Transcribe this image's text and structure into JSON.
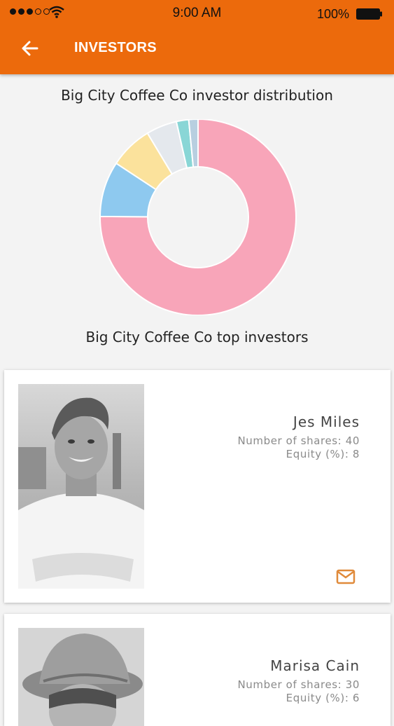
{
  "status_bar": {
    "time": "9:00 AM",
    "battery": "100%"
  },
  "header": {
    "title": "INVESTORS",
    "back_icon": "arrow-left-icon"
  },
  "distribution": {
    "title": "Big City Coffee Co investor distribution",
    "chart_data": {
      "type": "pie",
      "donut": true,
      "slices": [
        {
          "value": 74,
          "color": "#f8a5b9"
        },
        {
          "value": 9,
          "color": "#8ec9ef"
        },
        {
          "value": 7,
          "color": "#fbe29c"
        },
        {
          "value": 5,
          "color": "#e4e8ed"
        },
        {
          "value": 2,
          "color": "#89d6d6"
        },
        {
          "value": 1.5,
          "color": "#b8cfe0"
        }
      ]
    }
  },
  "top_investors": {
    "title": "Big City Coffee Co top investors",
    "investors": [
      {
        "name": "Jes Miles",
        "shares": "Number of shares: 40",
        "equity": "Equity (%): 8",
        "mail_icon": "mail-icon"
      },
      {
        "name": "Marisa Cain",
        "shares": "Number of shares: 30",
        "equity": "Equity (%): 6"
      }
    ]
  },
  "colors": {
    "accent": "#ec6a0c",
    "mail_icon": "#e08a3a"
  }
}
